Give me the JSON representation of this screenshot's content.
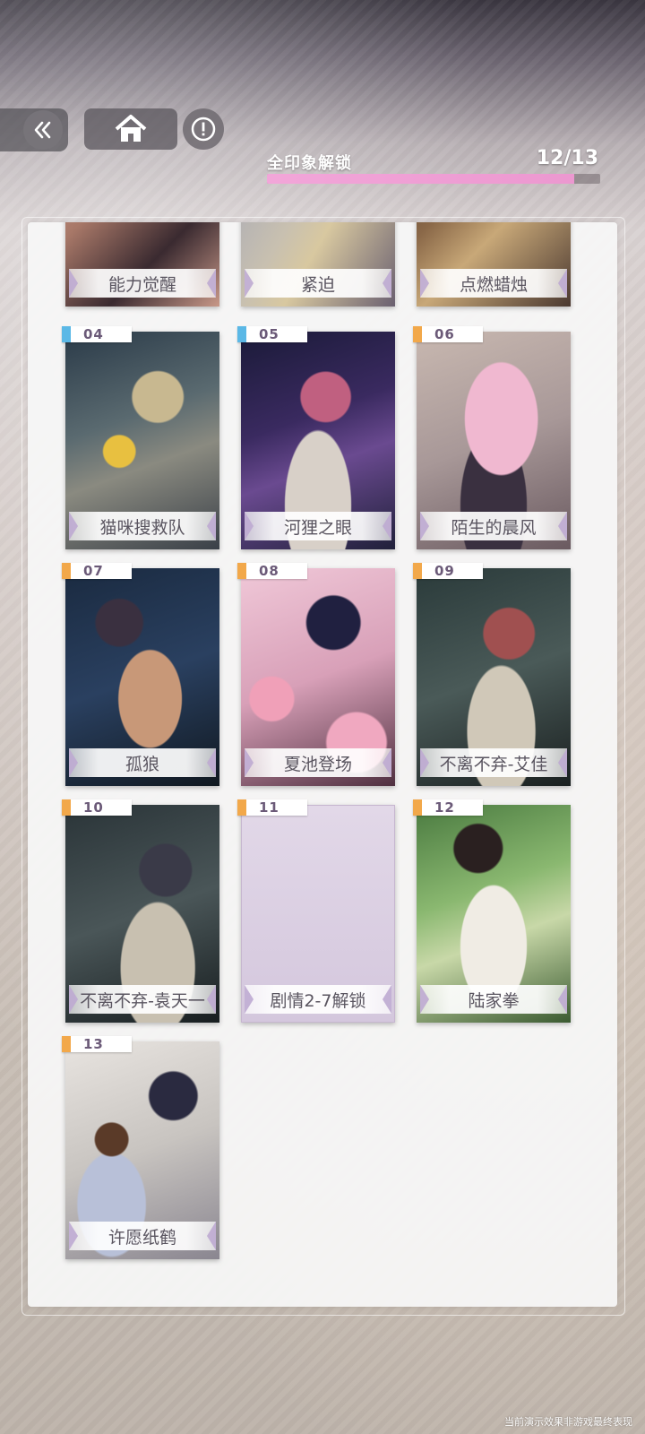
{
  "header": {
    "progress_label": "全印象解锁",
    "progress_count": "12/13",
    "progress_fraction": 0.923
  },
  "icons": {
    "back": "double-chevron-left-icon",
    "home": "home-icon",
    "info": "exclamation-circle-icon"
  },
  "colors": {
    "progress_fill": "#f2a6d9",
    "tag_blue": "#5bb8e6",
    "tag_orange": "#f2a84a"
  },
  "cards": [
    {
      "number": "",
      "title": "能力觉醒"
    },
    {
      "number": "",
      "title": "紧迫"
    },
    {
      "number": "",
      "title": "点燃蜡烛"
    },
    {
      "number": "04",
      "title": "猫咪搜救队",
      "tag_color": "#5bb8e6"
    },
    {
      "number": "05",
      "title": "河狸之眼",
      "tag_color": "#5bb8e6"
    },
    {
      "number": "06",
      "title": "陌生的晨风",
      "tag_color": "#f2a84a"
    },
    {
      "number": "07",
      "title": "孤狼",
      "tag_color": "#f2a84a"
    },
    {
      "number": "08",
      "title": "夏池登场",
      "tag_color": "#f2a84a"
    },
    {
      "number": "09",
      "title": "不离不弃-艾佳",
      "tag_color": "#f2a84a"
    },
    {
      "number": "10",
      "title": "不离不弃-袁天一",
      "tag_color": "#f2a84a"
    },
    {
      "number": "11",
      "title": "剧情2-7解锁",
      "tag_color": "#f2a84a",
      "locked": true
    },
    {
      "number": "12",
      "title": "陆家拳",
      "tag_color": "#f2a84a"
    },
    {
      "number": "13",
      "title": "许愿纸鹤",
      "tag_color": "#f2a84a"
    }
  ],
  "footer_note": "当前演示效果非游戏最终表现"
}
